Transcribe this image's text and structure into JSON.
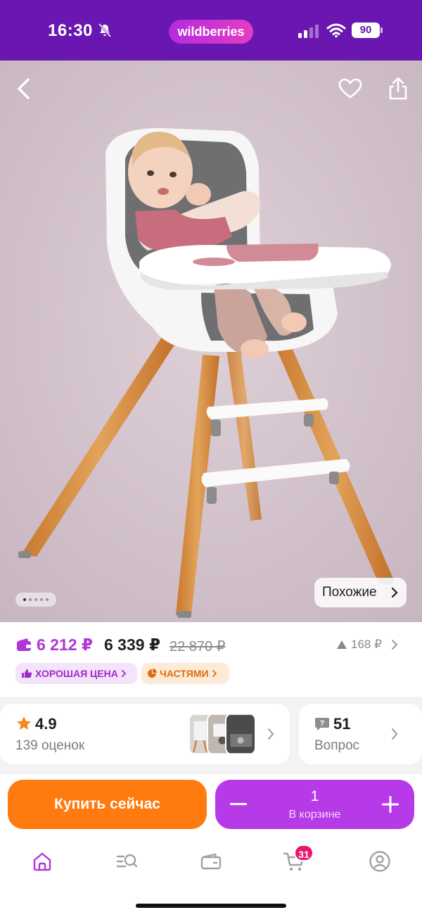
{
  "status_bar": {
    "time": "16:30",
    "app_logo": "wildberries",
    "battery": "90",
    "icons": [
      "bell-muted-icon",
      "signal-icon",
      "wifi-icon",
      "battery-icon"
    ]
  },
  "hero": {
    "image_icon": "high-chair-photo",
    "similar_label": "Похожие",
    "dots_count": 5,
    "active_dot": 0,
    "icons": [
      "back-arrow-icon",
      "heart-icon",
      "share-icon"
    ]
  },
  "price": {
    "wallet_price": "6 212 ₽",
    "price": "6 339 ₽",
    "old_price": "22 870 ₽",
    "price_change": "168 ₽",
    "badges": [
      {
        "label": "ХОРОШАЯ ЦЕНА",
        "icon": "thumbs-up-icon",
        "color": "#a02ac8"
      },
      {
        "label": "ЧАСТЯМИ",
        "icon": "pie-icon",
        "color": "#e06c12"
      }
    ]
  },
  "rating": {
    "value": "4.9",
    "count_label": "139 оценок"
  },
  "questions": {
    "value": "51",
    "label": "Вопрос"
  },
  "actions": {
    "buy_label": "Купить сейчас",
    "cart_qty": "1",
    "cart_label": "В корзине"
  },
  "bottom_nav": {
    "items": [
      "home-icon",
      "catalog-search-icon",
      "wallet-icon",
      "cart-icon",
      "profile-icon"
    ],
    "cart_count": "31"
  },
  "colors": {
    "brand_purple": "#6a16b0",
    "accent_purple": "#b73ae8",
    "orange": "#ff7a0f",
    "badge_red": "#e6186b"
  }
}
